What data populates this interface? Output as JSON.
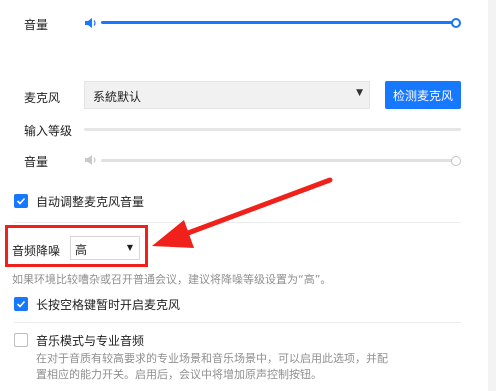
{
  "output": {
    "volume_label": "音量",
    "volume_level": 1.0
  },
  "microphone": {
    "label": "麦克风",
    "device_value": "系統默认",
    "test_button": "检测麦克风",
    "input_level_label": "输入等级",
    "input_level": 0.0,
    "volume_label": "音量",
    "volume_level": 1.0
  },
  "auto_adjust": {
    "label": "自动调整麦克风音量",
    "checked": true
  },
  "noise_suppression": {
    "label": "音频降噪",
    "value": "高",
    "hint": "如果环境比较嘈杂或召开普通会议，建议将降噪等级设置为“高”。"
  },
  "push_to_talk": {
    "label": "长按空格键暂时开启麦克风",
    "checked": true
  },
  "music_mode": {
    "label": "音乐模式与专业音频",
    "checked": false,
    "desc_line1": "在对于音质有较高要求的专业场景和音乐场景中，可以启用此选项，并配",
    "desc_line2": "置相应的能力开关。启用后，会议中将增加原声控制按钮。"
  },
  "colors": {
    "accent": "#1677ff",
    "annotation": "#f0201a"
  },
  "icons": [
    "speaker-icon",
    "speaker-muted-icon",
    "caret-down-icon",
    "checkbox-checked-icon",
    "annotation-arrow"
  ]
}
